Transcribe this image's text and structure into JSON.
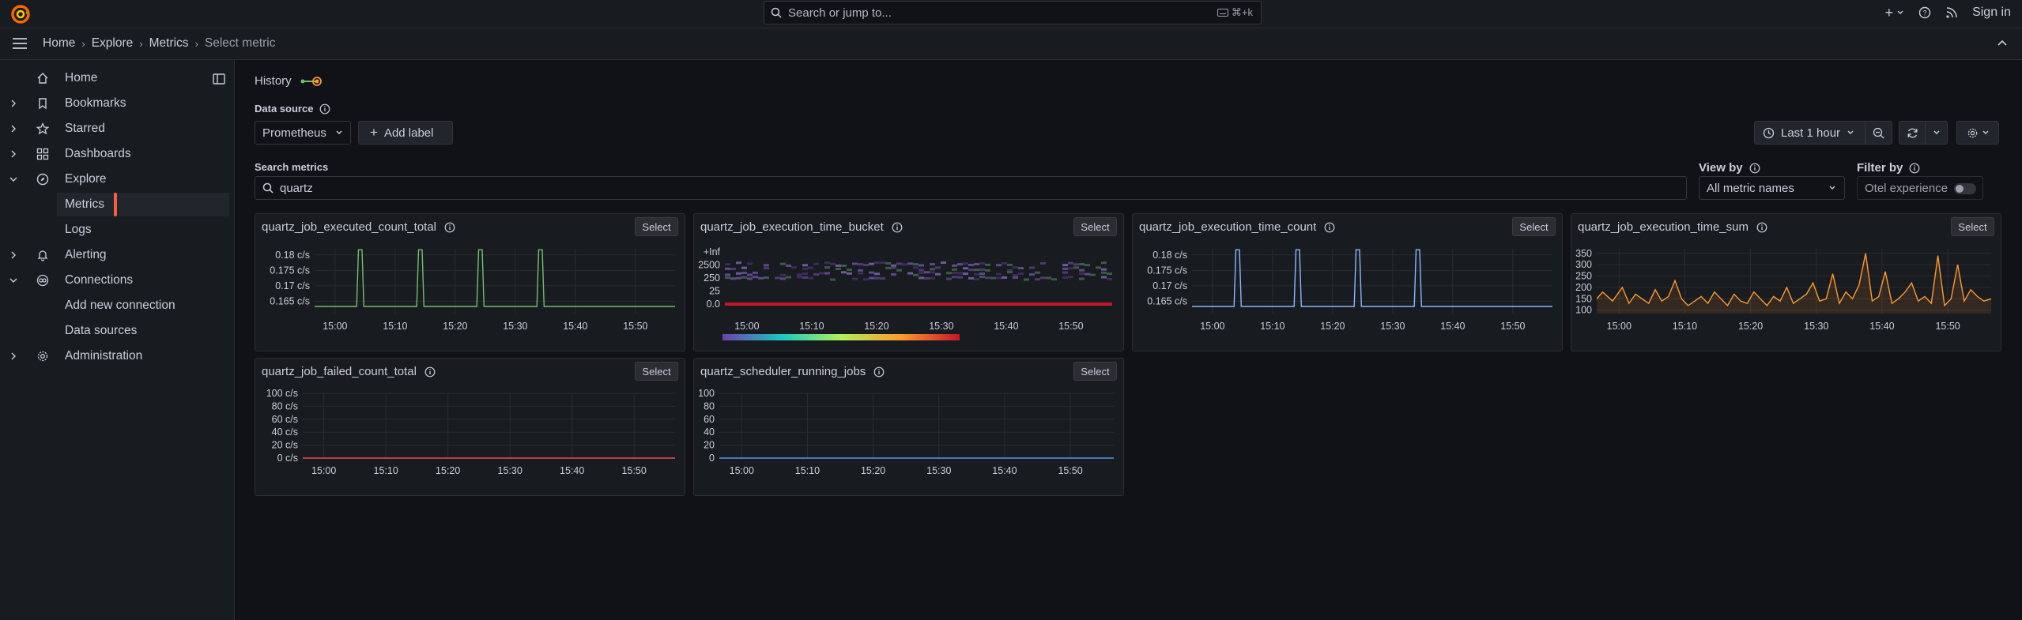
{
  "topbar": {
    "search_placeholder": "Search or jump to...",
    "shortcut": "⌘+k",
    "sign_in": "Sign in"
  },
  "breadcrumb": [
    "Home",
    "Explore",
    "Metrics",
    "Select metric"
  ],
  "sidebar": {
    "items": [
      {
        "label": "Home",
        "icon": "home-icon"
      },
      {
        "label": "Bookmarks",
        "icon": "bookmark-icon"
      },
      {
        "label": "Starred",
        "icon": "star-icon"
      },
      {
        "label": "Dashboards",
        "icon": "dashboards-icon"
      },
      {
        "label": "Explore",
        "icon": "compass-icon"
      },
      {
        "label": "Metrics",
        "icon": ""
      },
      {
        "label": "Logs",
        "icon": ""
      },
      {
        "label": "Alerting",
        "icon": "bell-icon"
      },
      {
        "label": "Connections",
        "icon": "connections-icon"
      },
      {
        "label": "Add new connection",
        "icon": ""
      },
      {
        "label": "Data sources",
        "icon": ""
      },
      {
        "label": "Administration",
        "icon": "gear-icon"
      }
    ]
  },
  "main": {
    "history_label": "History",
    "data_source_label": "Data source",
    "data_source_value": "Prometheus",
    "add_label": "Add label",
    "time_range": "Last 1 hour",
    "search_metrics_label": "Search metrics",
    "search_value": "quartz",
    "view_by_label": "View by",
    "view_by_value": "All metric names",
    "filter_by_label": "Filter by",
    "otel_label": "Otel experience",
    "select_label": "Select"
  },
  "colors": {
    "accent": "#f55f3e",
    "green": "#73bf69",
    "blue": "#8ab8ff",
    "orange": "#ff9830",
    "red": "#f2495c"
  },
  "chart_data": [
    {
      "type": "line",
      "title": "quartz_job_executed_count_total",
      "ytick_labels": [
        "0.165 c/s",
        "0.17 c/s",
        "0.175 c/s",
        "0.18 c/s"
      ],
      "ylim": [
        0.161,
        0.182
      ],
      "xtick_labels": [
        "15:00",
        "15:10",
        "15:20",
        "15:30",
        "15:40",
        "15:50"
      ],
      "xlim": [
        -3.4,
        56.6
      ],
      "x": [
        -3.4,
        3.6,
        3.9,
        4.5,
        4.8,
        13.6,
        13.9,
        14.5,
        14.8,
        23.6,
        23.9,
        24.5,
        24.8,
        33.6,
        33.9,
        34.5,
        34.8,
        56.6
      ],
      "values": [
        0.1633,
        0.1633,
        0.1817,
        0.1817,
        0.1633,
        0.1633,
        0.1817,
        0.1817,
        0.1633,
        0.1633,
        0.1817,
        0.1817,
        0.1633,
        0.1633,
        0.1817,
        0.1817,
        0.1633,
        0.1633
      ],
      "color": "#73bf69"
    },
    {
      "type": "heatmap",
      "title": "quartz_job_execution_time_bucket",
      "ytick_labels": [
        "0.0",
        "25",
        "250",
        "2500",
        "+Inf"
      ],
      "xtick_labels": [
        "15:00",
        "15:10",
        "15:20",
        "15:30",
        "15:40",
        "15:50"
      ],
      "xlim": [
        -3.4,
        56.6
      ]
    },
    {
      "type": "line",
      "title": "quartz_job_execution_time_count",
      "ytick_labels": [
        "0.165 c/s",
        "0.17 c/s",
        "0.175 c/s",
        "0.18 c/s"
      ],
      "ylim": [
        0.161,
        0.182
      ],
      "xtick_labels": [
        "15:00",
        "15:10",
        "15:20",
        "15:30",
        "15:40",
        "15:50"
      ],
      "xlim": [
        -3.4,
        56.6
      ],
      "x": [
        -3.4,
        3.6,
        3.9,
        4.5,
        4.8,
        13.6,
        13.9,
        14.5,
        14.8,
        23.6,
        23.9,
        24.5,
        24.8,
        33.6,
        33.9,
        34.5,
        34.8,
        56.6
      ],
      "values": [
        0.1633,
        0.1633,
        0.1817,
        0.1817,
        0.1633,
        0.1633,
        0.1817,
        0.1817,
        0.1633,
        0.1633,
        0.1817,
        0.1817,
        0.1633,
        0.1633,
        0.1817,
        0.1817,
        0.1633,
        0.1633
      ],
      "color": "#8ab8ff"
    },
    {
      "type": "area",
      "title": "quartz_job_execution_time_sum",
      "ytick_labels": [
        "100",
        "150",
        "200",
        "250",
        "300",
        "350"
      ],
      "ylim": [
        85,
        370
      ],
      "xtick_labels": [
        "15:00",
        "15:10",
        "15:20",
        "15:30",
        "15:40",
        "15:50"
      ],
      "xlim": [
        -3.4,
        56.6
      ],
      "x": [
        -3.4,
        -2.5,
        -1,
        0.5,
        1.5,
        2.5,
        3.5,
        4.5,
        5.5,
        6.5,
        7.5,
        8.5,
        9.5,
        10.5,
        11.5,
        12.5,
        13.5,
        14.5,
        15.5,
        16.5,
        17.5,
        18.5,
        19.5,
        20.5,
        21.5,
        22.5,
        23.5,
        24.5,
        25.5,
        26.5,
        27.5,
        28.5,
        29.5,
        30.5,
        31.5,
        32.5,
        33.5,
        34.5,
        35.5,
        36.5,
        37.5,
        38.5,
        39.5,
        40.5,
        41.5,
        42.5,
        43.5,
        44.5,
        45.5,
        46.5,
        47.5,
        48.5,
        49.5,
        50.5,
        51.5,
        52.5,
        53.5,
        54.5,
        55.5,
        56.6
      ],
      "values": [
        150,
        180,
        140,
        200,
        130,
        170,
        150,
        130,
        190,
        140,
        160,
        230,
        150,
        120,
        140,
        160,
        130,
        180,
        150,
        120,
        170,
        140,
        130,
        180,
        150,
        120,
        160,
        140,
        200,
        130,
        150,
        170,
        220,
        140,
        150,
        260,
        130,
        180,
        150,
        210,
        350,
        140,
        160,
        270,
        130,
        150,
        180,
        220,
        140,
        160,
        130,
        340,
        120,
        150,
        300,
        140,
        190,
        160,
        140,
        150
      ],
      "color": "#ff9830"
    },
    {
      "type": "line",
      "title": "quartz_job_failed_count_total",
      "ytick_labels": [
        "0 c/s",
        "20 c/s",
        "40 c/s",
        "60 c/s",
        "80 c/s",
        "100 c/s"
      ],
      "ylim": [
        0,
        100
      ],
      "xtick_labels": [
        "15:00",
        "15:10",
        "15:20",
        "15:30",
        "15:40",
        "15:50"
      ],
      "xlim": [
        -3.4,
        56.6
      ],
      "x": [
        -3.4,
        56.6
      ],
      "values": [
        0,
        0
      ],
      "color": "#f2495c"
    },
    {
      "type": "line",
      "title": "quartz_scheduler_running_jobs",
      "ytick_labels": [
        "0",
        "20",
        "40",
        "60",
        "80",
        "100"
      ],
      "ylim": [
        0,
        100
      ],
      "xtick_labels": [
        "15:00",
        "15:10",
        "15:20",
        "15:30",
        "15:40",
        "15:50"
      ],
      "xlim": [
        -3.4,
        56.6
      ],
      "x": [
        -3.4,
        56.6
      ],
      "values": [
        0,
        0
      ],
      "color": "#5794f2"
    }
  ]
}
